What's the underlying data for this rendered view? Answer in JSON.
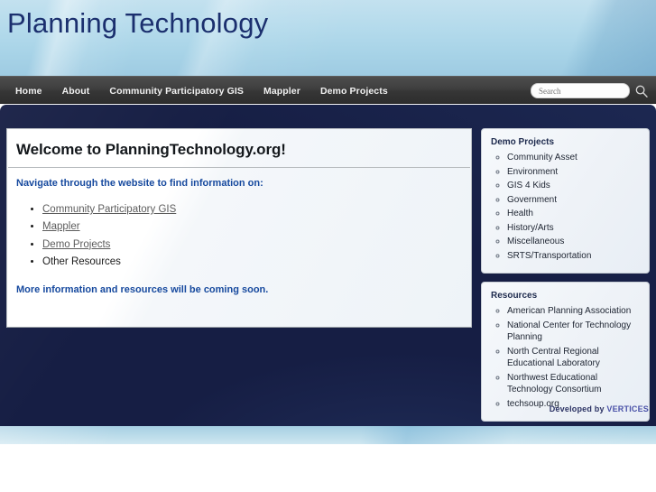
{
  "site": {
    "title": "Planning Technology"
  },
  "nav": {
    "items": [
      {
        "label": "Home"
      },
      {
        "label": "About"
      },
      {
        "label": "Community Participatory GIS"
      },
      {
        "label": "Mappler"
      },
      {
        "label": "Demo Projects"
      }
    ],
    "search": {
      "placeholder": "Search",
      "value": "",
      "icon": "search-icon"
    }
  },
  "main": {
    "heading": "Welcome to PlanningTechnology.org!",
    "lead": "Navigate through the website to find information on:",
    "links": [
      {
        "label": "Community Participatory GIS",
        "is_link": true
      },
      {
        "label": "Mappler",
        "is_link": true
      },
      {
        "label": "Demo Projects",
        "is_link": true
      },
      {
        "label": "Other Resources",
        "is_link": false
      }
    ],
    "closing": "More information and resources will be coming soon."
  },
  "sidebar": {
    "widgets": [
      {
        "title": "Demo Projects",
        "items": [
          {
            "label": "Community Asset"
          },
          {
            "label": "Environment"
          },
          {
            "label": "GIS 4 Kids"
          },
          {
            "label": "Government"
          },
          {
            "label": "Health"
          },
          {
            "label": "History/Arts"
          },
          {
            "label": "Miscellaneous"
          },
          {
            "label": "SRTS/Transportation"
          }
        ]
      },
      {
        "title": "Resources",
        "items": [
          {
            "label": "American Planning Association"
          },
          {
            "label": "National Center for Technology Planning"
          },
          {
            "label": "North Central Regional Educational Laboratory"
          },
          {
            "label": "Northwest Educational Technology Consortium"
          },
          {
            "label": "techsoup.org"
          }
        ]
      }
    ]
  },
  "footer": {
    "credit_prefix": "Developed by ",
    "credit_brand": "VERTICES"
  },
  "colors": {
    "banner_blue": "#b5dbec",
    "title_navy": "#1b2f6e",
    "navbar_dark": "#3f3f3f",
    "shell_navy": "#161e44",
    "lead_blue": "#16499e",
    "brand_purple": "#4a52a8"
  }
}
